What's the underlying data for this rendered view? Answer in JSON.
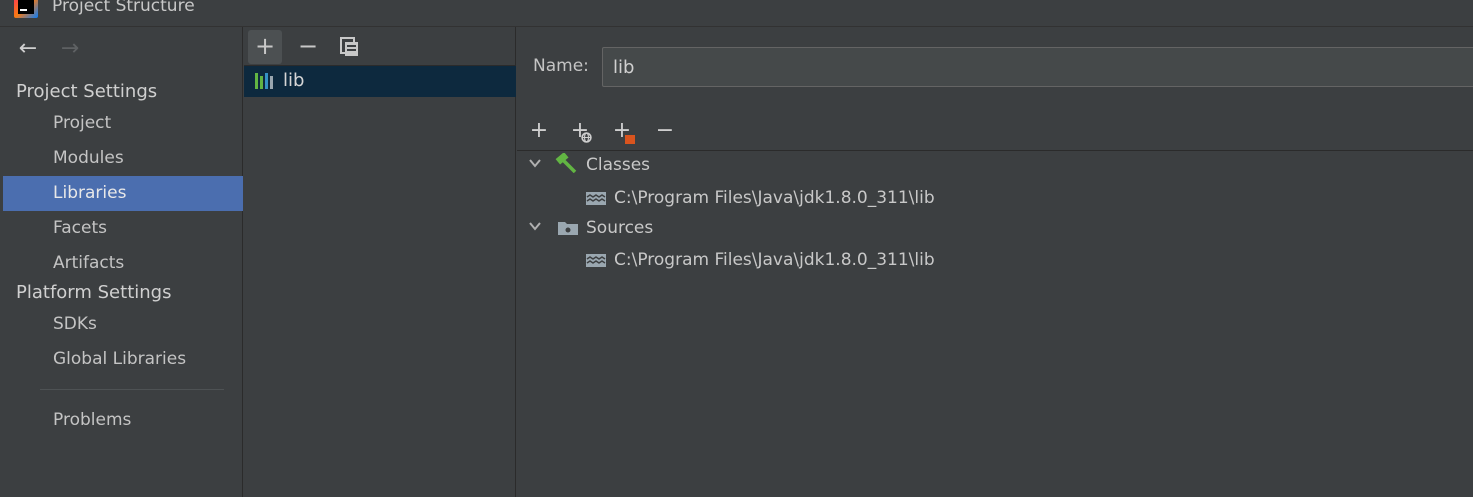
{
  "window": {
    "title": "Project Structure",
    "logo": "intellij-logo"
  },
  "nav": {
    "back_icon": "arrow-left-icon",
    "forward_icon": "arrow-right-icon",
    "project_settings_header": "Project Settings",
    "project_items": [
      "Project",
      "Modules",
      "Libraries",
      "Facets",
      "Artifacts"
    ],
    "platform_settings_header": "Platform Settings",
    "platform_items": [
      "SDKs",
      "Global Libraries"
    ],
    "problems": "Problems",
    "selected": "Libraries"
  },
  "library_list": {
    "toolbar": {
      "add": "+",
      "remove": "−",
      "copy_icon": "copy-icon"
    },
    "items": [
      "lib"
    ]
  },
  "detail": {
    "name_label": "Name:",
    "name_value": "lib",
    "toolbar": {
      "add": "+",
      "add_web": "+",
      "add_excluded": "+",
      "remove": "−"
    },
    "tree": {
      "classes_label": "Classes",
      "classes_path": "C:\\Program Files\\Java\\jdk1.8.0_311\\lib",
      "sources_label": "Sources",
      "sources_path": "C:\\Program Files\\Java\\jdk1.8.0_311\\lib"
    }
  },
  "colors": {
    "background": "#3c3f41",
    "selection": "#4b6eaf",
    "list_selection": "#0d293e",
    "hammer_green": "#62b543",
    "excluded_orange": "#d9541e"
  }
}
